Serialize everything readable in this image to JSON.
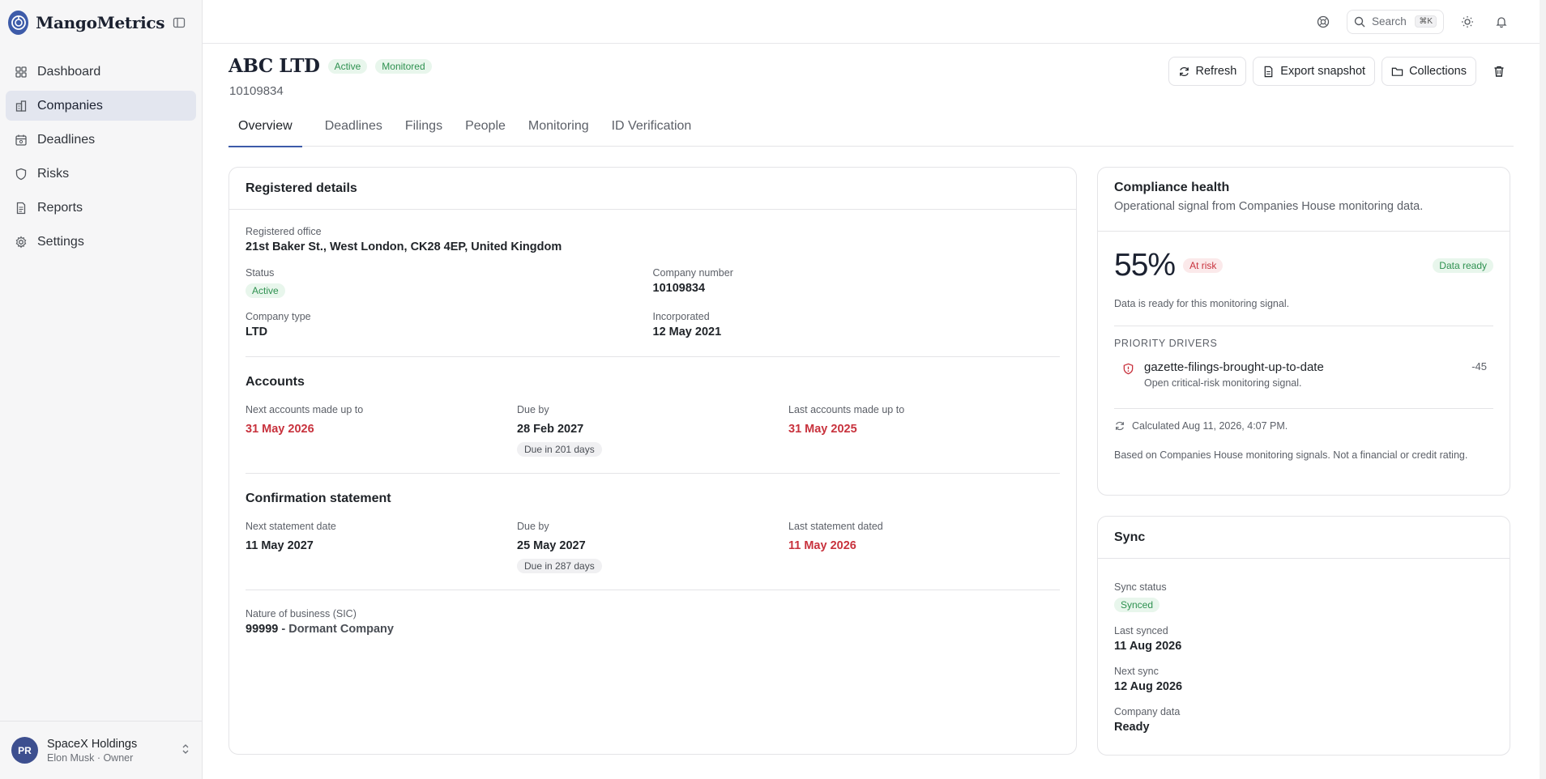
{
  "brand": {
    "name": "MangoMetrics"
  },
  "nav": [
    {
      "label": "Dashboard",
      "icon": "grid-icon"
    },
    {
      "label": "Companies",
      "icon": "building-icon",
      "active": true
    },
    {
      "label": "Deadlines",
      "icon": "calendar-icon"
    },
    {
      "label": "Risks",
      "icon": "shield-icon"
    },
    {
      "label": "Reports",
      "icon": "file-text-icon"
    },
    {
      "label": "Settings",
      "icon": "gear-icon"
    }
  ],
  "org": {
    "initials": "PR",
    "name": "SpaceX Holdings",
    "sub": "Elon Musk · Owner"
  },
  "topbar": {
    "search_label": "Search",
    "search_kbd": "⌘K"
  },
  "company": {
    "name": "ABC LTD",
    "badge_status": "Active",
    "badge_monitored": "Monitored",
    "number": "10109834"
  },
  "actions": {
    "refresh": "Refresh",
    "export": "Export snapshot",
    "collections": "Collections"
  },
  "tabs": [
    "Overview",
    "Deadlines",
    "Filings",
    "People",
    "Monitoring",
    "ID Verification"
  ],
  "registered": {
    "title": "Registered details",
    "office_label": "Registered office",
    "office_value": "21st Baker St., West London, CK28 4EP, United Kingdom",
    "status_label": "Status",
    "status_value": "Active",
    "number_label": "Company number",
    "number_value": "10109834",
    "type_label": "Company type",
    "type_value": "LTD",
    "incorporated_label": "Incorporated",
    "incorporated_value": "12 May 2021"
  },
  "accounts": {
    "title": "Accounts",
    "next_label": "Next accounts made up to",
    "next_value": "31 May 2026",
    "due_label": "Due by",
    "due_value": "28 Feb 2027",
    "due_pill": "Due in 201 days",
    "last_label": "Last accounts made up to",
    "last_value": "31 May 2025"
  },
  "confirmation": {
    "title": "Confirmation statement",
    "next_label": "Next statement date",
    "next_value": "11 May 2027",
    "due_label": "Due by",
    "due_value": "25 May 2027",
    "due_pill": "Due in 287 days",
    "last_label": "Last statement dated",
    "last_value": "11 May 2026"
  },
  "sic": {
    "label": "Nature of business (SIC)",
    "code": "99999",
    "sep": " - ",
    "desc": "Dormant Company"
  },
  "health": {
    "title": "Compliance health",
    "subtitle": "Operational signal from Companies House monitoring data.",
    "score": "55%",
    "score_value": 55,
    "risk_badge": "At risk",
    "data_badge": "Data ready",
    "note": "Data is ready for this monitoring signal.",
    "drivers_label": "PRIORITY DRIVERS",
    "driver_name": "gazette-filings-brought-up-to-date",
    "driver_desc": "Open critical-risk monitoring signal.",
    "driver_impact": "-45",
    "calculated": "Calculated Aug 11, 2026, 4:07 PM.",
    "footnote": "Based on Companies House monitoring signals. Not a financial or credit rating."
  },
  "sync": {
    "title": "Sync",
    "status_label": "Sync status",
    "status_value": "Synced",
    "last_label": "Last synced",
    "last_value": "11 Aug 2026",
    "next_label": "Next sync",
    "next_value": "12 Aug 2026",
    "data_label": "Company data",
    "data_value": "Ready"
  },
  "colors": {
    "accent": "#3d5ba9",
    "danger": "#c8323d",
    "success": "#2e9150"
  }
}
